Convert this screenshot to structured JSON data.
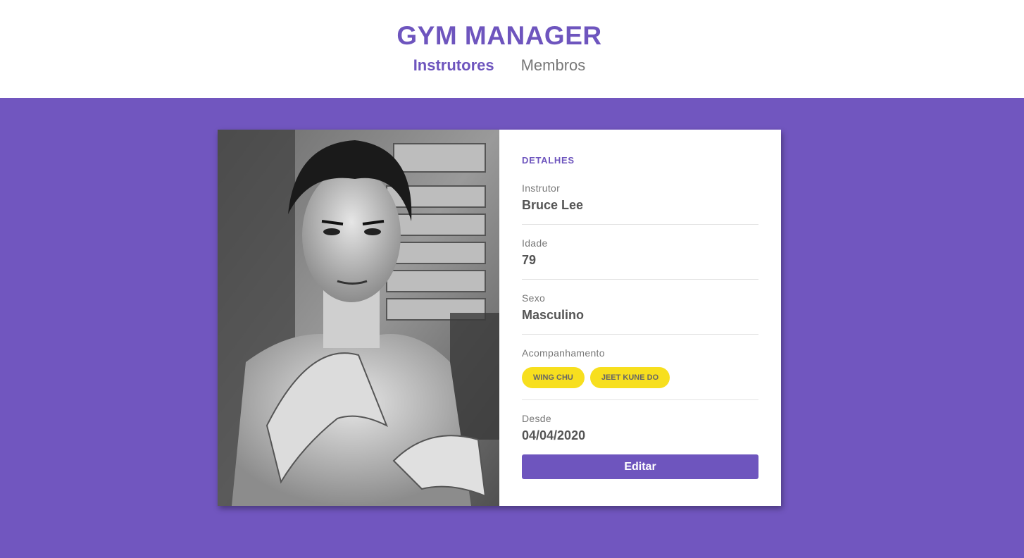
{
  "app": {
    "title": "GYM MANAGER"
  },
  "nav": {
    "items": [
      {
        "label": "Instrutores",
        "active": true
      },
      {
        "label": "Membros",
        "active": false
      }
    ]
  },
  "card": {
    "photo_icon": "instructor-photo",
    "section_title": "DETALHES",
    "fields": {
      "instructor": {
        "label": "Instrutor",
        "value": "Bruce Lee"
      },
      "age": {
        "label": "Idade",
        "value": "79"
      },
      "gender": {
        "label": "Sexo",
        "value": "Masculino"
      },
      "services": {
        "label": "Acompanhamento",
        "items": [
          "WING CHU",
          "JEET KUNE DO"
        ]
      },
      "since": {
        "label": "Desde",
        "value": "04/04/2020"
      }
    },
    "edit_label": "Editar"
  },
  "colors": {
    "accent": "#6e55be",
    "background": "#7156bf",
    "chip": "#f7df1e"
  }
}
